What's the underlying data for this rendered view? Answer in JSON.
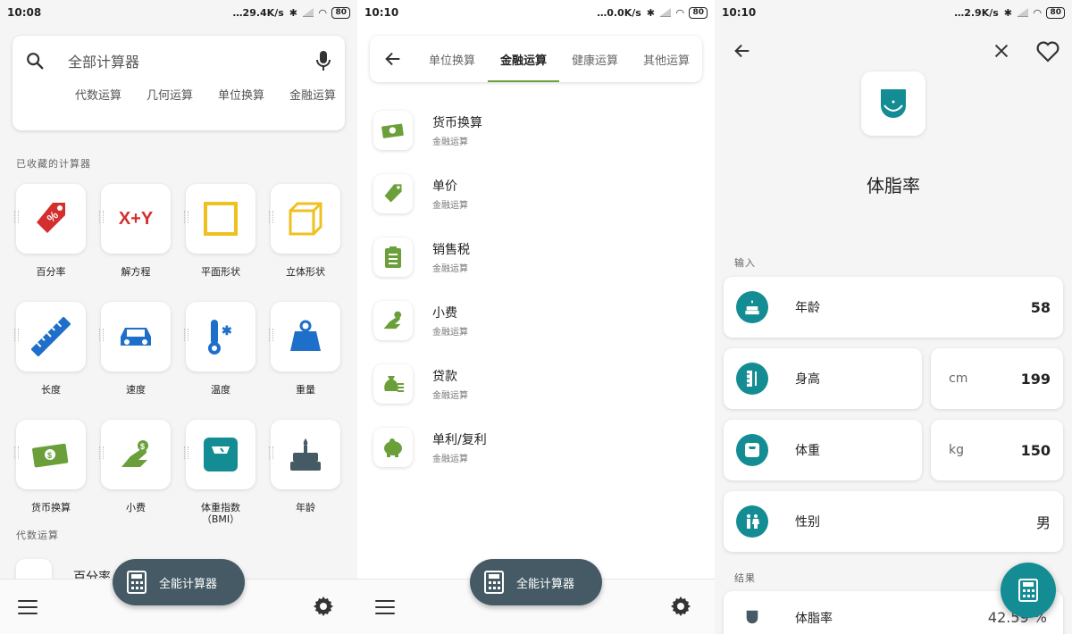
{
  "screen1": {
    "status": {
      "time": "10:08",
      "speed": "29.4K/s",
      "battery": "80"
    },
    "search": {
      "placeholder": "全部计算器"
    },
    "chips": [
      "代数运算",
      "几何运算",
      "单位换算",
      "金融运算"
    ],
    "favorites_label": "已收藏的计算器",
    "tiles": [
      {
        "label": "百分率",
        "icon": "percent-tag-icon"
      },
      {
        "label": "解方程",
        "icon": "x-plus-y-icon"
      },
      {
        "label": "平面形状",
        "icon": "square-icon"
      },
      {
        "label": "立体形状",
        "icon": "cube-icon"
      },
      {
        "label": "长度",
        "icon": "ruler-icon"
      },
      {
        "label": "速度",
        "icon": "car-icon"
      },
      {
        "label": "温度",
        "icon": "thermometer-icon"
      },
      {
        "label": "重量",
        "icon": "weight-icon"
      },
      {
        "label": "货币换算",
        "icon": "money-icon"
      },
      {
        "label": "小费",
        "icon": "tip-hand-icon"
      },
      {
        "label": "体重指数（BMI）",
        "icon": "scale-icon"
      },
      {
        "label": "年龄",
        "icon": "cake-icon"
      }
    ],
    "algebra_label": "代数运算",
    "peek_item": "百分率",
    "fab_label": "全能计算器"
  },
  "screen2": {
    "status": {
      "time": "10:10",
      "speed": "0.0K/s",
      "battery": "80"
    },
    "tabs": [
      "单位换算",
      "金融运算",
      "健康运算",
      "其他运算"
    ],
    "items": [
      {
        "title": "货币换算",
        "sub": "金融运算",
        "icon": "money-icon"
      },
      {
        "title": "单价",
        "sub": "金融运算",
        "icon": "price-tag-icon"
      },
      {
        "title": "销售税",
        "sub": "金融运算",
        "icon": "receipt-icon"
      },
      {
        "title": "小费",
        "sub": "金融运算",
        "icon": "tip-hand-icon"
      },
      {
        "title": "贷款",
        "sub": "金融运算",
        "icon": "money-bag-icon"
      },
      {
        "title": "单利/复利",
        "sub": "金融运算",
        "icon": "piggy-bank-icon"
      }
    ],
    "fab_label": "全能计算器"
  },
  "screen3": {
    "status": {
      "time": "10:10",
      "speed": "2.9K/s",
      "battery": "80"
    },
    "title": "体脂率",
    "input_label": "输入",
    "fields": {
      "age": {
        "label": "年龄",
        "value": "58"
      },
      "height": {
        "label": "身高",
        "unit": "cm",
        "value": "199"
      },
      "weight": {
        "label": "体重",
        "unit": "kg",
        "value": "150"
      },
      "gender": {
        "label": "性别",
        "value": "男"
      }
    },
    "result_label": "结果",
    "result": {
      "label": "体脂率",
      "value": "42.59 %"
    }
  },
  "colors": {
    "teal": "#138d93",
    "green": "#6a9f3a",
    "fab": "#455a64",
    "red": "#d32f2f",
    "yellow": "#f0c020",
    "blue": "#1e6fc9"
  }
}
